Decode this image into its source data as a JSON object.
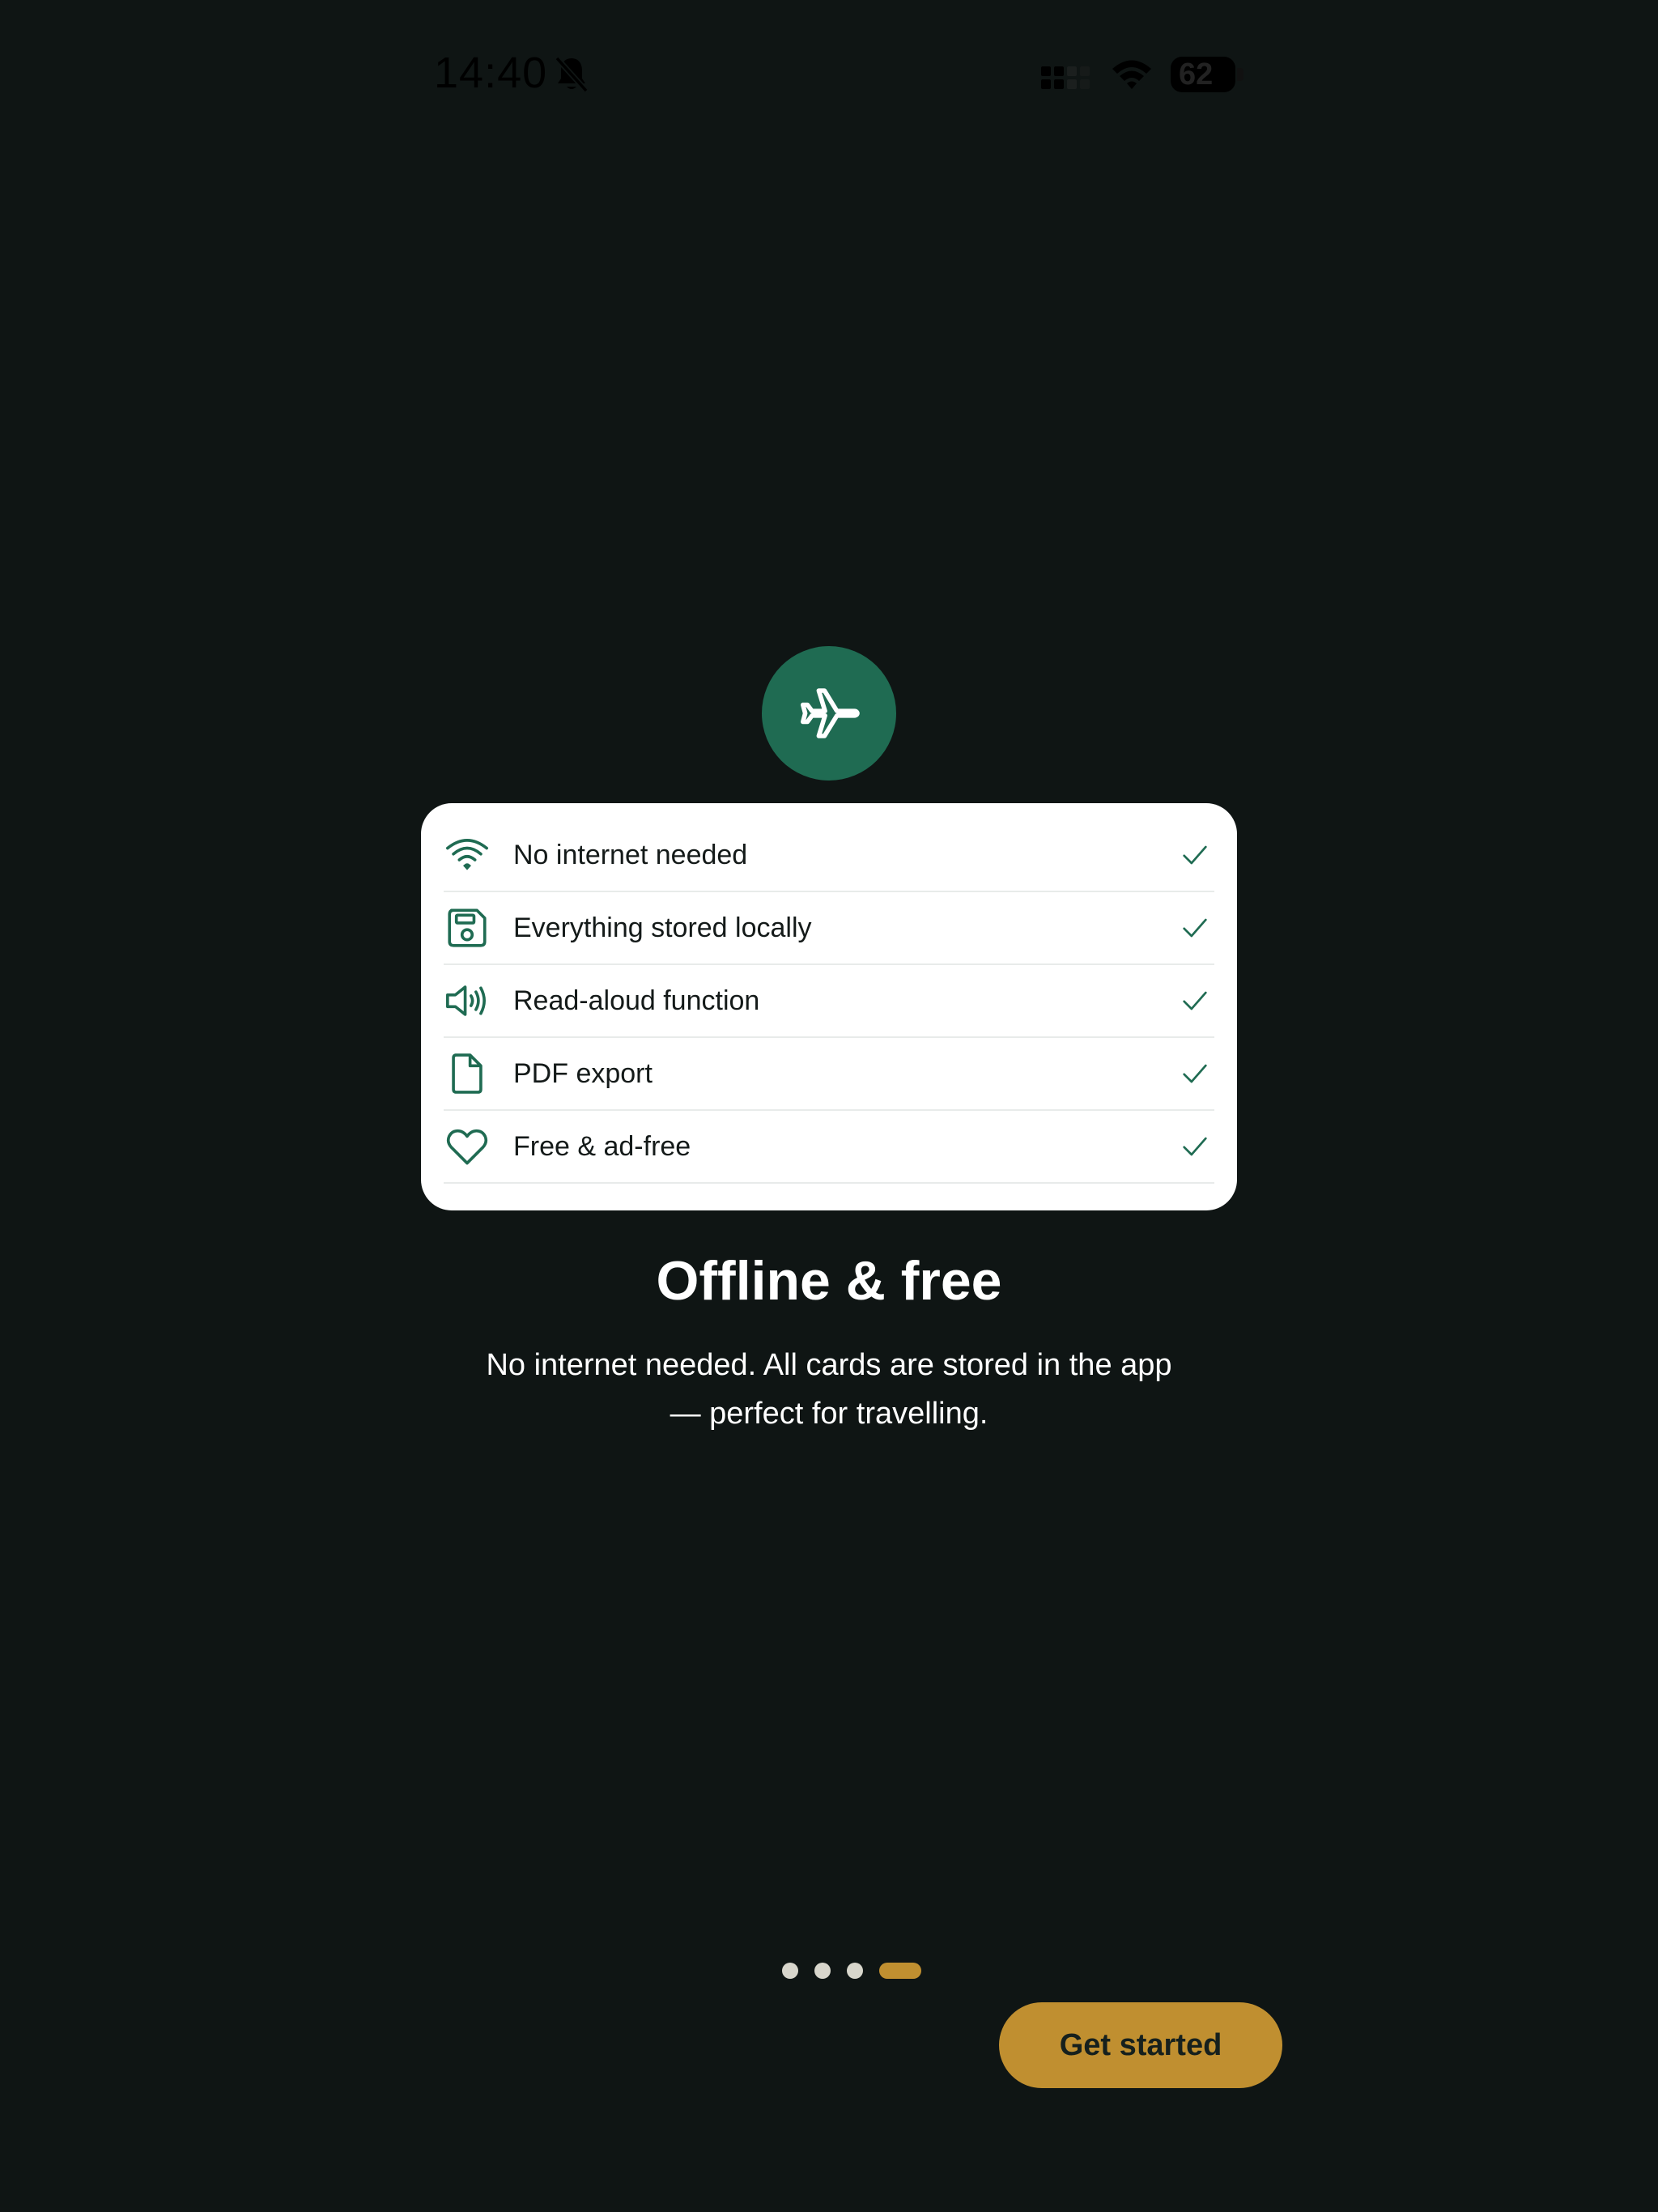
{
  "status_bar": {
    "time": "14:40",
    "battery_level": "62",
    "icons": [
      "bell-slash-icon",
      "cellular-grid-icon",
      "wifi-icon",
      "battery-icon"
    ]
  },
  "hero": {
    "icon": "airplane-icon",
    "color": "#1f6b52"
  },
  "features": [
    {
      "icon": "wifi-icon",
      "label": "No internet needed",
      "checked": true
    },
    {
      "icon": "floppy-disk-icon",
      "label": "Everything stored locally",
      "checked": true
    },
    {
      "icon": "speaker-icon",
      "label": "Read-aloud function",
      "checked": true
    },
    {
      "icon": "document-icon",
      "label": "PDF export",
      "checked": true
    },
    {
      "icon": "heart-icon",
      "label": "Free & ad-free",
      "checked": true
    }
  ],
  "title": "Offline & free",
  "description_line1": "No internet needed. All cards are stored in the app",
  "description_line2": "— perfect for travelling.",
  "pager": {
    "total": 4,
    "current": 4
  },
  "cta": {
    "label": "Get started"
  },
  "colors": {
    "background": "#0f1514",
    "accent": "#c08f30",
    "brand_green": "#1f6b52",
    "card": "#ffffff"
  }
}
